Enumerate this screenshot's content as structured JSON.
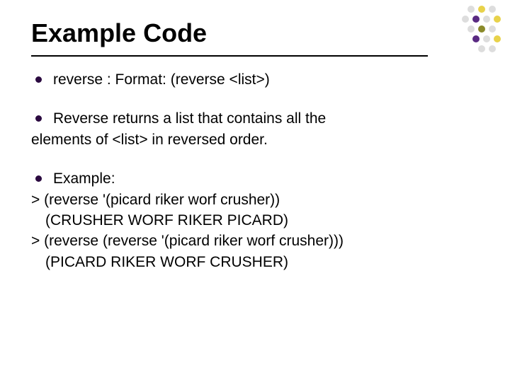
{
  "title": "Example Code",
  "b1": "reverse : Format: (reverse <list>)",
  "b2_first": "Reverse returns a list that contains all the",
  "b2_cont": "elements of <list> in reversed order.",
  "b3_first": "Example:",
  "code1": "> (reverse '(picard riker worf crusher))",
  "code2": "(CRUSHER WORF RIKER PICARD)",
  "code3": "> (reverse (reverse '(picard riker worf crusher)))",
  "code4": "(PICARD RIKER WORF CRUSHER)",
  "dots": {
    "colors": {
      "purple": "#5a2a82",
      "yellow": "#e8d24a",
      "olive": "#8a8a2a",
      "grey": "#dddddd"
    }
  }
}
